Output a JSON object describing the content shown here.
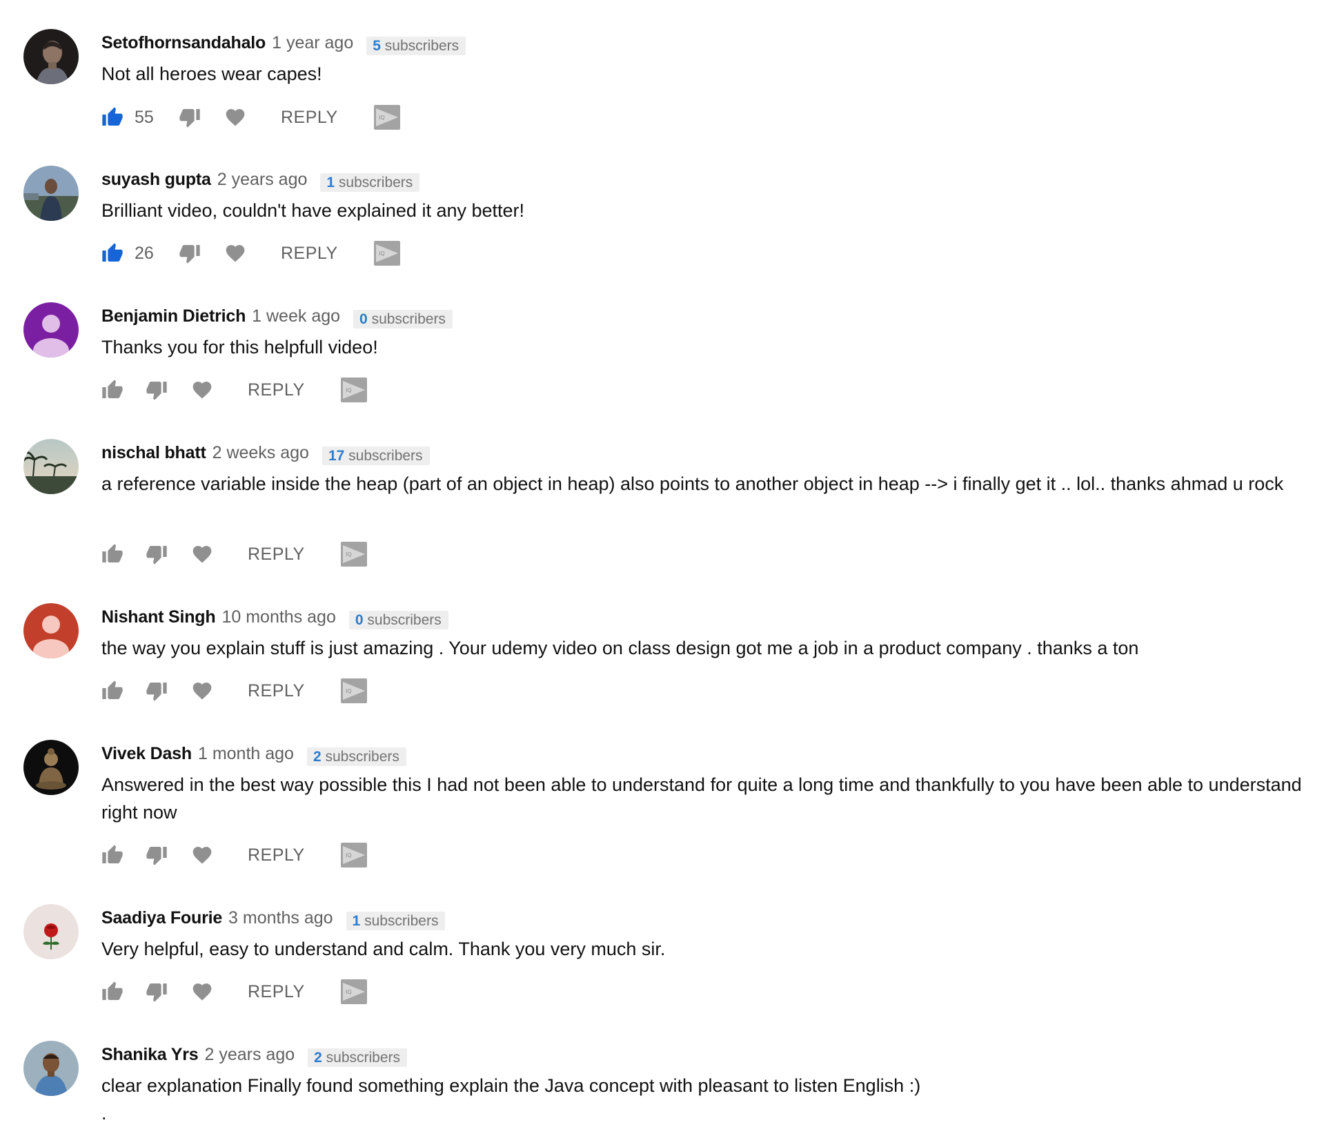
{
  "ui": {
    "reply_label": "REPLY",
    "subscribers_suffix": "subscribers"
  },
  "colors": {
    "like_active": "#1565d8",
    "icon_gray": "#909090",
    "subscriber_count": "#2a7ccf"
  },
  "icons": [
    "thumb-up-icon",
    "thumb-down-icon",
    "heart-icon",
    "extension-play-icon"
  ],
  "comments": [
    {
      "author": "Setofhornsandahalo",
      "time": "1 year ago",
      "subscribers": "5",
      "text": "Not all heroes wear capes!",
      "likes": "55",
      "liked": true,
      "avatar": "photo-dark"
    },
    {
      "author": "suyash gupta",
      "time": "2 years ago",
      "subscribers": "1",
      "text": "Brilliant video, couldn't have explained it any better!",
      "likes": "26",
      "liked": true,
      "avatar": "photo-outdoor"
    },
    {
      "author": "Benjamin Dietrich",
      "time": "1 week ago",
      "subscribers": "0",
      "text": "Thanks you for this helpfull video!",
      "likes": "",
      "liked": false,
      "avatar": "default-purple"
    },
    {
      "author": "nischal bhatt",
      "time": "2 weeks ago",
      "subscribers": "17",
      "text": "a reference variable inside the heap (part of an object in heap) also points to another object in heap --> i finally get it .. lol.. thanks ahmad u rock",
      "likes": "",
      "liked": false,
      "avatar": "photo-palms"
    },
    {
      "author": "Nishant Singh",
      "time": "10 months ago",
      "subscribers": "0",
      "text": "the way you explain stuff is just amazing . Your udemy video on class design got me a job in a product company . thanks a ton",
      "likes": "",
      "liked": false,
      "avatar": "default-red"
    },
    {
      "author": "Vivek Dash",
      "time": "1 month ago",
      "subscribers": "2",
      "text": "Answered in the best way possible this I had not been able to understand for quite a long time and thankfully to you have been able to understand right now",
      "likes": "",
      "liked": false,
      "avatar": "photo-buddha"
    },
    {
      "author": "Saadiya Fourie",
      "time": "3 months ago",
      "subscribers": "1",
      "text": "Very helpful, easy to understand and calm. Thank you very much sir.",
      "likes": "",
      "liked": false,
      "avatar": "photo-rose"
    },
    {
      "author": "Shanika Yrs",
      "time": "2 years ago",
      "subscribers": "2",
      "text": "clear explanation Finally found something explain the Java concept with pleasant to listen English :)\n.",
      "likes": "",
      "liked": false,
      "avatar": "photo-man"
    }
  ]
}
